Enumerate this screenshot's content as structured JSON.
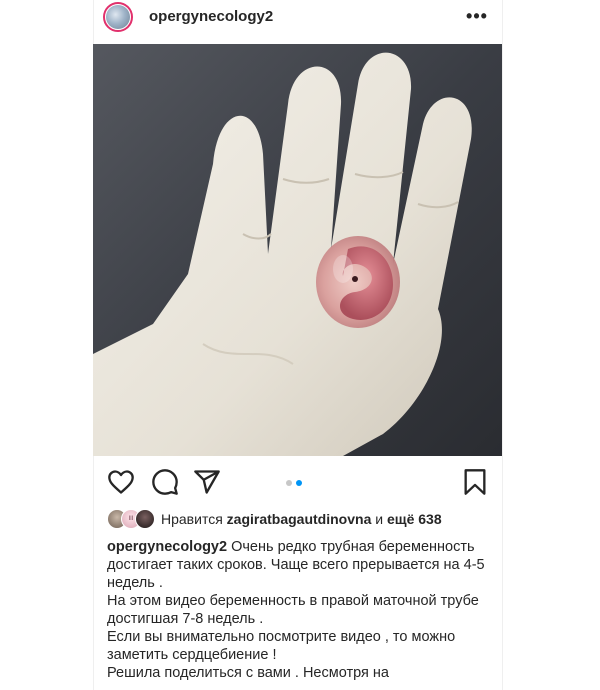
{
  "header": {
    "username": "opergynecology2",
    "more_icon": "more-horizontal-icon",
    "more_label": "•••"
  },
  "photo": {
    "description_icon": "post-photo"
  },
  "actions": {
    "like_icon": "heart-icon",
    "comment_icon": "comment-icon",
    "share_icon": "send-icon",
    "save_icon": "bookmark-icon",
    "carousel": {
      "count": 2,
      "active": 2
    }
  },
  "likes": {
    "avatar_badge": "III",
    "prefix": "Нравится ",
    "user": "zagiratbagautdinovna",
    "middle": " и ",
    "others": "ещё 638"
  },
  "caption": {
    "user": "opergynecology2",
    "lines": [
      "Очень редко трубная беременность достигает таких сроков. Чаще всего прерывается на 4-5 недель .",
      "На этом видео беременность в правой маточной трубе достигшая 7-8 недель .",
      "Если вы внимательно посмотрите видео , то можно заметить сердцебиение !",
      "Решила поделиться с вами . Несмотря на"
    ]
  },
  "colors": {
    "accent": "#0095f6",
    "text": "#262626",
    "ring": "#e1306c"
  }
}
